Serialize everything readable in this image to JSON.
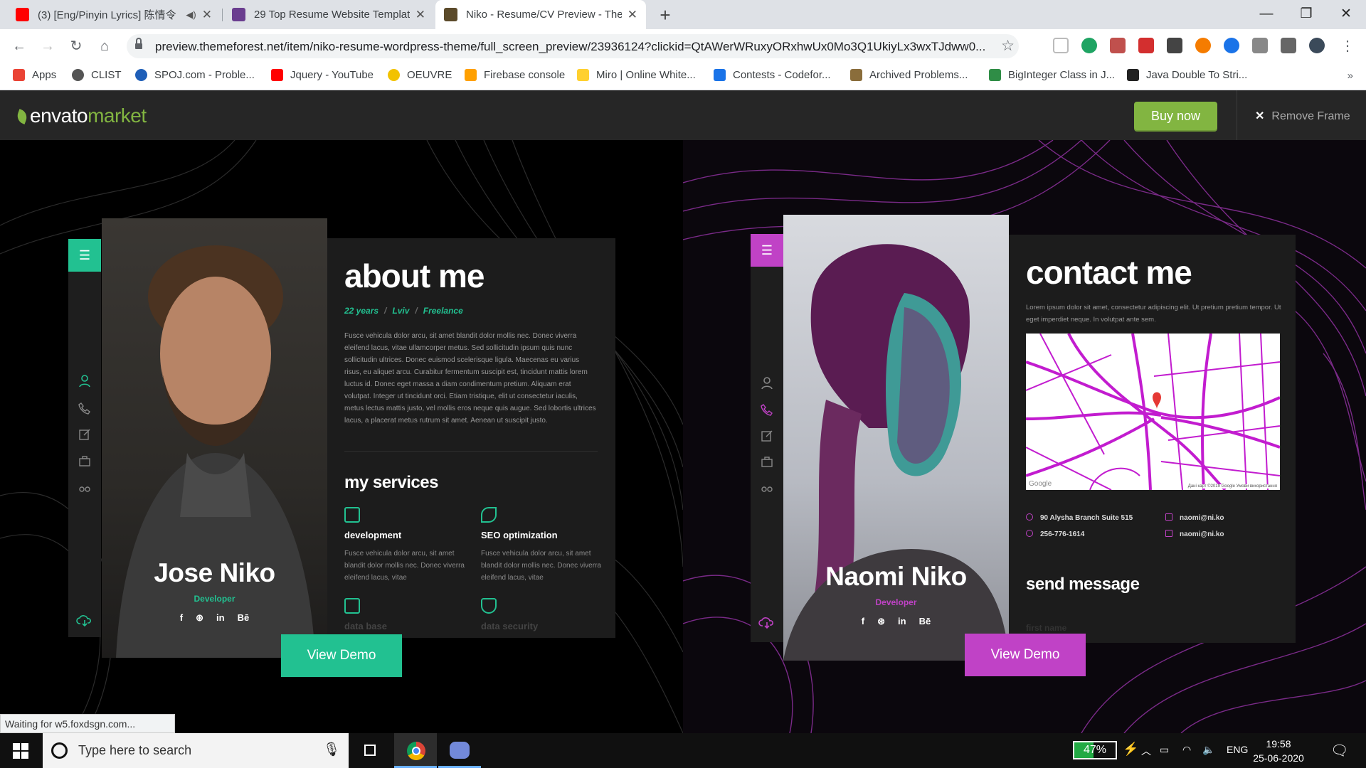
{
  "browser": {
    "tabs": [
      {
        "title": "(3) [Eng/Pinyin Lyrics] 陈情令",
        "favicon_color": "#ff0000",
        "icon": "youtube-icon"
      },
      {
        "title": "29 Top Resume Website Templates",
        "favicon_color": "#6a3d8f",
        "icon": "colorlib-icon"
      },
      {
        "title": "Niko - Resume/CV Preview - ThemeForest",
        "favicon_color": "#5b4a2a",
        "icon": "themeforest-icon"
      }
    ],
    "new_tab": "+",
    "url": "preview.themeforest.net/item/niko-resume-wordpress-theme/full_screen_preview/23936124?clickid=QtAWerWRuxyORxhwUx0Mo3Q1UkiyLx3wxTJdww0...",
    "bookmarks": [
      {
        "label": "Apps",
        "color": "#ea4335",
        "icon": "apps-grid-icon"
      },
      {
        "label": "CLIST",
        "color": "#555555",
        "icon": "clist-icon"
      },
      {
        "label": "SPOJ.com - Proble...",
        "color": "#1f5fb8",
        "icon": "spoj-icon"
      },
      {
        "label": "Jquery - YouTube",
        "color": "#ff0000",
        "icon": "youtube-icon"
      },
      {
        "label": "OEUVRE",
        "color": "#f2c200",
        "icon": "oeuvre-icon"
      },
      {
        "label": "Firebase console",
        "color": "#ffa000",
        "icon": "firebase-icon"
      },
      {
        "label": "Miro | Online White...",
        "color": "#ffd02f",
        "icon": "miro-icon"
      },
      {
        "label": "Contests - Codefor...",
        "color": "#1a73e8",
        "icon": "codeforces-icon"
      },
      {
        "label": "Archived Problems...",
        "color": "#8a6d3b",
        "icon": "project-euler-icon"
      },
      {
        "label": "BigInteger Class in J...",
        "color": "#2f8d46",
        "icon": "gfg-icon"
      },
      {
        "label": "Java Double To Stri...",
        "color": "#222222",
        "icon": "javanotes-icon"
      }
    ]
  },
  "envato": {
    "logo_a": "envato",
    "logo_b": "market",
    "buy_now": "Buy now",
    "remove_frame": "Remove Frame",
    "accent": "#82b541"
  },
  "demo1": {
    "accent": "#22c191",
    "name": "Jose Niko",
    "role": "Developer",
    "socials": [
      "f",
      "⊛",
      "in",
      "Bē"
    ],
    "heading": "about me",
    "meta": [
      "22 years",
      "Lviv",
      "Freelance"
    ],
    "bio": "Fusce vehicula dolor arcu, sit amet blandit dolor mollis nec. Donec viverra eleifend lacus, vitae ullamcorper metus. Sed sollicitudin ipsum quis nunc sollicitudin ultrices. Donec euismod scelerisque ligula. Maecenas eu varius risus, eu aliquet arcu. Curabitur fermentum suscipit est, tincidunt mattis lorem luctus id. Donec eget massa a diam condimentum pretium. Aliquam erat volutpat. Integer ut tincidunt orci. Etiam tristique, elit ut consectetur iaculis, metus lectus mattis justo, vel mollis eros neque quis augue. Sed lobortis ultrices lacus, a placerat metus rutrum sit amet. Aenean ut suscipit justo.",
    "services_heading": "my services",
    "services": [
      {
        "title": "development",
        "desc": "Fusce vehicula dolor arcu, sit amet blandit dolor mollis nec. Donec viverra eleifend lacus, vitae",
        "icon": "monitor-icon"
      },
      {
        "title": "SEO optimization",
        "desc": "Fusce vehicula dolor arcu, sit amet blandit dolor mollis nec. Donec viverra eleifend lacus, vitae",
        "icon": "rocket-icon"
      }
    ],
    "more_services": [
      "data base",
      "data security"
    ],
    "view_demo": "View Demo"
  },
  "demo2": {
    "accent": "#c042c6",
    "name": "Naomi Niko",
    "role": "Developer",
    "socials": [
      "f",
      "⊛",
      "in",
      "Bē"
    ],
    "heading": "contact me",
    "intro": "Lorem ipsum dolor sit amet, consectetur adipiscing elit. Ut pretium pretium tempor. Ut eget imperdiet neque. In volutpat ante sem.",
    "map_credit": "Дані карт ©2019 Google   Умови використання",
    "map_google": "Google",
    "contacts": [
      {
        "text": "90 Alysha Branch Suite 515",
        "icon": "location-icon"
      },
      {
        "text": "naomi@ni.ko",
        "icon": "mail-icon"
      },
      {
        "text": "256-776-1614",
        "icon": "phone-icon"
      },
      {
        "text": "naomi@ni.ko",
        "icon": "mail-icon"
      }
    ],
    "send_heading": "send message",
    "fade_label": "first name",
    "view_demo": "View Demo"
  },
  "status_text": "Waiting for w5.foxdsgn.com...",
  "taskbar": {
    "search_placeholder": "Type here to search",
    "battery": "47%",
    "battery_level": 0.47,
    "lang": "ENG",
    "time": "19:58",
    "date": "25-06-2020"
  }
}
